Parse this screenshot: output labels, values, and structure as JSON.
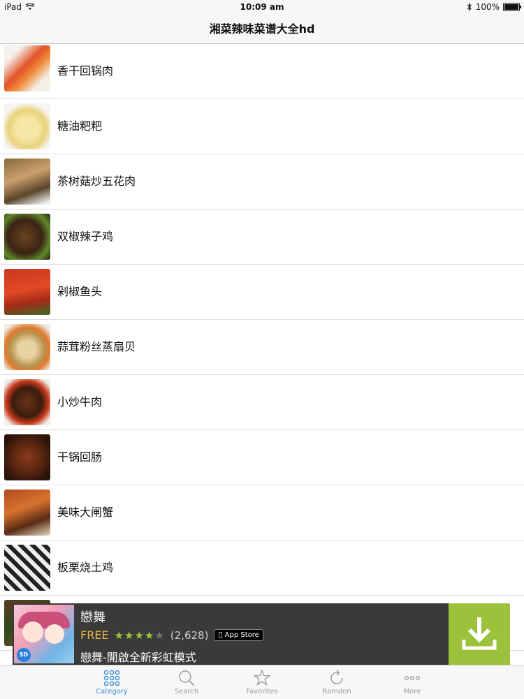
{
  "status": {
    "device": "iPad",
    "time": "10:09 am",
    "battery": "100%"
  },
  "nav": {
    "title": "湘菜辣味菜谱大全hd"
  },
  "recipes": [
    {
      "name": "香干回锅肉",
      "thumb": "linear-gradient(135deg,#f4f1ec 20%,#e0552a 45%,#f08a3a 60%,#f3efe6 80%)"
    },
    {
      "name": "糖油粑粑",
      "thumb": "radial-gradient(circle at 50% 55%,#f6e7a6 30%,#e9d27a 55%,#f5f5ef 75%)"
    },
    {
      "name": "茶树菇炒五花肉",
      "thumb": "linear-gradient(160deg,#8a6a3e,#c9a06b 40%,#5b452a 70%,#eee 95%)"
    },
    {
      "name": "双椒辣子鸡",
      "thumb": "radial-gradient(circle at 45% 50%,#6b4420,#3a2414 50%,#5d8a2a 75%,#2a1c10)"
    },
    {
      "name": "剁椒鱼头",
      "thumb": "linear-gradient(170deg,#c8381f,#e24a25 45%,#a72a16 70%,#3d6b24)"
    },
    {
      "name": "蒜茸粉丝蒸扇贝",
      "thumb": "radial-gradient(circle at 50% 55%,#e8d3a2 25%,#b8934f 50%,#e07a2f 65%,#eeeae0 85%)"
    },
    {
      "name": "小炒牛肉",
      "thumb": "radial-gradient(circle at 50% 50%,#6a3218,#3b1c0e 45%,#c83a1c 65%,#f0ece6 85%)"
    },
    {
      "name": "干锅回肠",
      "thumb": "radial-gradient(circle at 50% 50%,#8a3a1e,#55240f 50%,#2a140a 80%)"
    },
    {
      "name": "美味大闸蟹",
      "thumb": "linear-gradient(160deg,#b34a1f,#d8722f 40%,#5a2b14 70%,#e8d8c0)"
    },
    {
      "name": "板栗烧土鸡",
      "thumb": "repeating-linear-gradient(45deg,#222 0 6px,#eee 6px 12px)"
    },
    {
      "name": "",
      "thumb": "linear-gradient(160deg,#5a3a1e,#2e4a1c 50%,#7a4a22)"
    }
  ],
  "ad": {
    "title": "戀舞",
    "price": "FREE",
    "stars": "★★★★",
    "stars_dim": "★",
    "rating_count": "(2,628)",
    "store_badge": " App Store",
    "subtitle": "戀舞-開啟全新彩虹模式",
    "sd_badge": "SD",
    "colors": {
      "background": "#3a3a3a",
      "download": "#9cc23b"
    }
  },
  "tabs": [
    {
      "label": "Category",
      "icon": "grid-icon",
      "active": true
    },
    {
      "label": "Search",
      "icon": "search-icon",
      "active": false
    },
    {
      "label": "Favorites",
      "icon": "star-icon",
      "active": false
    },
    {
      "label": "Ramdon",
      "icon": "refresh-icon",
      "active": false
    },
    {
      "label": "More",
      "icon": "more-icon",
      "active": false
    }
  ],
  "colors": {
    "accent": "#3b8dd8",
    "tab_inactive": "#9a9a9a"
  }
}
